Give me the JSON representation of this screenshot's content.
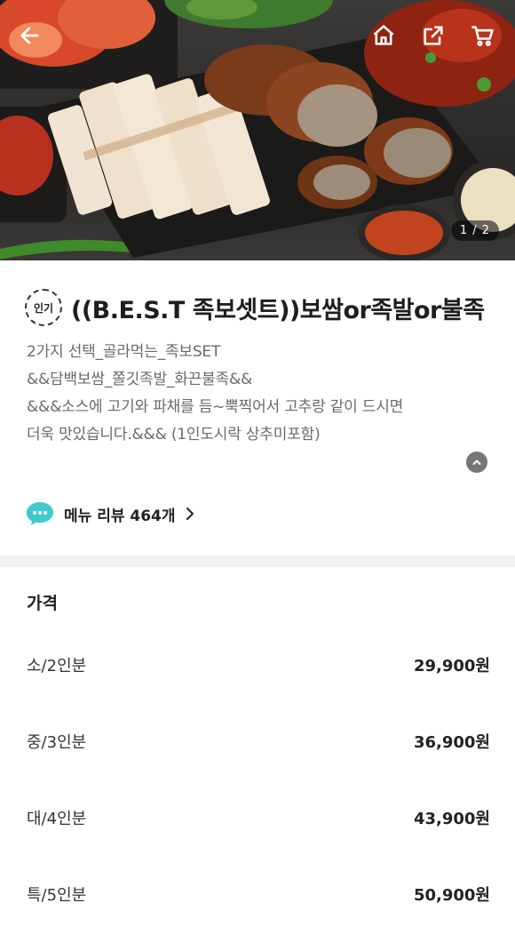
{
  "header": {
    "back_icon": "back-arrow-icon",
    "home_icon": "home-icon",
    "share_icon": "share-icon",
    "cart_icon": "cart-icon",
    "image_counter": "1 / 2"
  },
  "product": {
    "badge": "인기",
    "title": "((B.E.S.T 족보셋트))보쌈or족발or불족",
    "description_lines": [
      "2가지 선택_골라먹는_족보SET",
      "&&담백보쌈_쫄깃족발_화끈불족&&",
      "&&&소스에 고기와 파채를 듬~뿍찍어서 고추랑 같이 드시면",
      "더욱 맛있습니다.&&& (1인도시락 상추미포함)"
    ],
    "review_link": "메뉴 리뷰 464개"
  },
  "price": {
    "heading": "가격",
    "options": [
      {
        "label": "소/2인분",
        "price": "29,900원"
      },
      {
        "label": "중/3인분",
        "price": "36,900원"
      },
      {
        "label": "대/4인분",
        "price": "43,900원"
      },
      {
        "label": "특/5인분",
        "price": "50,900원"
      }
    ]
  },
  "colors": {
    "review_bubble": "#3ec9cf",
    "divider": "#f2f2f4",
    "description": "#6a6a6a"
  }
}
